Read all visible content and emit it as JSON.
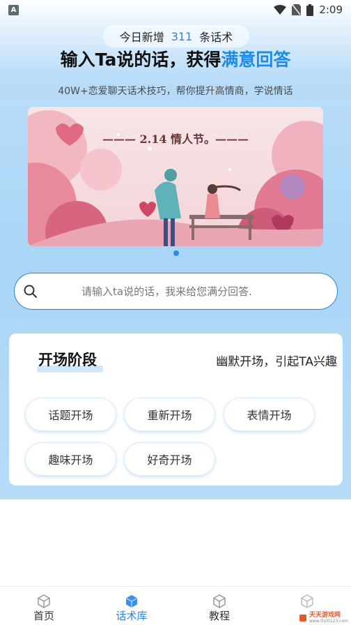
{
  "status_bar": {
    "time": "2:09",
    "app_badge": "A"
  },
  "counter": {
    "prefix": "今日新增",
    "count": "311",
    "suffix": "条话术"
  },
  "headline": {
    "main": "输入Ta说的话，获得",
    "highlight": "满意回答"
  },
  "subline": "40W+恋爱聊天话术技巧，帮你提升高情商，学说情话",
  "banner": {
    "title": "——— 2.14 情人节。———"
  },
  "search": {
    "placeholder": "请输入ta说的话，我来给您满分回答."
  },
  "stage": {
    "title": "开场阶段",
    "description": "幽默开场，引起TA兴趣",
    "chips": [
      "话题开场",
      "重新开场",
      "表情开场",
      "趣味开场",
      "好奇开场"
    ]
  },
  "tabs": [
    {
      "label": "首页",
      "icon": "cube-icon"
    },
    {
      "label": "话术库",
      "icon": "cube-icon",
      "active": true
    },
    {
      "label": "教程",
      "icon": "cube-icon"
    },
    {
      "label": "",
      "icon": "cube-icon"
    }
  ],
  "watermark": {
    "text": "天天游戏网",
    "url": "www.ttyl0123.com"
  },
  "colors": {
    "accent": "#2b86e0",
    "highlight": "#1e8ce6"
  }
}
